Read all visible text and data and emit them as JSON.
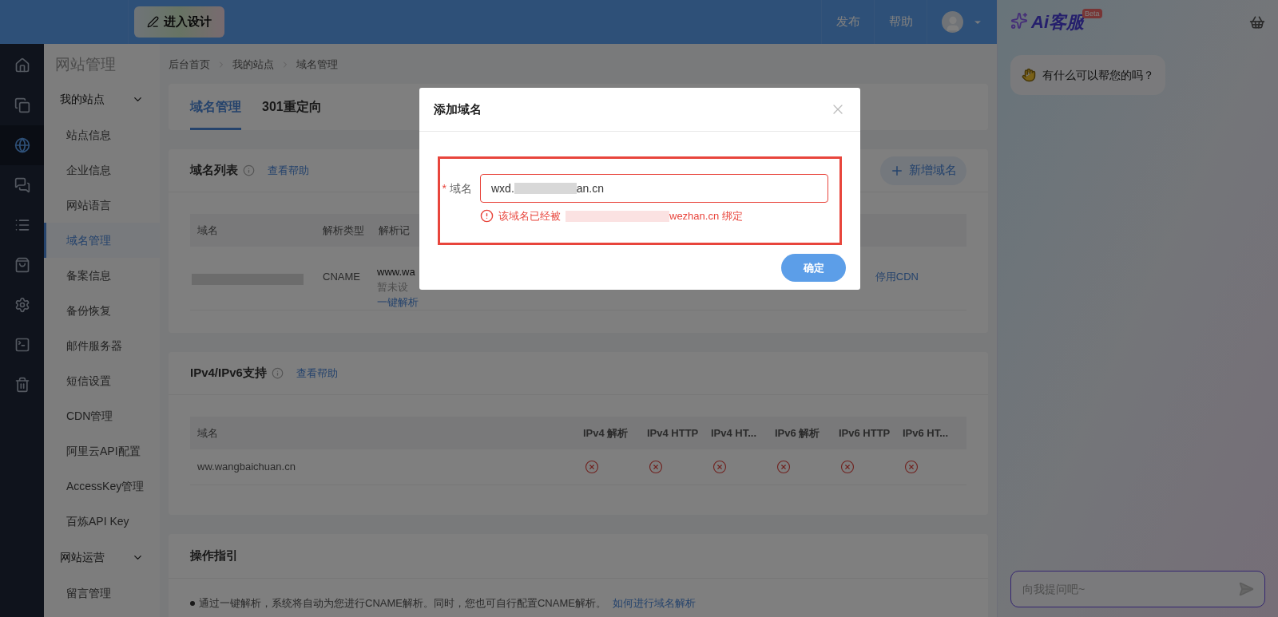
{
  "top_bar": {
    "design_button": "进入设计",
    "menu": [
      "发布",
      "帮助"
    ]
  },
  "icon_rail": [
    {
      "kind": "home",
      "selected": false
    },
    {
      "kind": "pages",
      "selected": false
    },
    {
      "kind": "globe",
      "selected": true
    },
    {
      "kind": "chat",
      "selected": false
    },
    {
      "kind": "list",
      "selected": false
    },
    {
      "kind": "bag",
      "selected": false
    },
    {
      "kind": "settings",
      "selected": false
    },
    {
      "kind": "terminal",
      "selected": false
    },
    {
      "kind": "trash",
      "selected": false
    }
  ],
  "sidebar": {
    "title": "网站管理",
    "groups": [
      {
        "label": "我的站点",
        "expanded": true,
        "items": [
          {
            "label": "站点信息",
            "selected": false
          },
          {
            "label": "企业信息",
            "selected": false
          },
          {
            "label": "网站语言",
            "selected": false
          },
          {
            "label": "域名管理",
            "selected": true
          },
          {
            "label": "备案信息",
            "selected": false
          },
          {
            "label": "备份恢复",
            "selected": false
          },
          {
            "label": "邮件服务器",
            "selected": false
          },
          {
            "label": "短信设置",
            "selected": false
          },
          {
            "label": "CDN管理",
            "selected": false
          },
          {
            "label": "阿里云API配置",
            "selected": false
          },
          {
            "label": "AccessKey管理",
            "selected": false
          },
          {
            "label": "百炼API Key",
            "selected": false
          }
        ]
      },
      {
        "label": "网站运营",
        "expanded": true,
        "items": [
          {
            "label": "留言管理",
            "selected": false
          }
        ]
      }
    ]
  },
  "breadcrumb": [
    "后台首页",
    "我的站点",
    "域名管理"
  ],
  "tabs": [
    {
      "label": "域名管理",
      "selected": true
    },
    {
      "label": "301重定向",
      "selected": false
    }
  ],
  "domain_list": {
    "title": "域名列表",
    "help_link": "查看帮助",
    "add_button": "新增域名",
    "columns": [
      "域名",
      "解析类型",
      "解析记"
    ],
    "rows": [
      {
        "type": "CNAME",
        "record": "www.wa",
        "note": "暂未设",
        "action": "一键解析",
        "right_link": "停用CDN"
      }
    ]
  },
  "ip_support": {
    "title": "IPv4/IPv6支持",
    "help_link": "查看帮助",
    "columns": [
      "域名",
      "IPv4 解析",
      "IPv4 HTTP",
      "IPv4 HT...",
      "IPv6 解析",
      "IPv6 HTTP",
      "IPv6 HT..."
    ],
    "rows": [
      {
        "domain": "ww.wangbaichuan.cn",
        "flags": [
          false,
          false,
          false,
          false,
          false,
          false
        ]
      }
    ]
  },
  "guide": {
    "title": "操作指引",
    "items": [
      {
        "text": "通过一键解析，系统将自动为您进行CNAME解析。同时，您也可自行配置CNAME解析。",
        "link": "如何进行域名解析"
      }
    ]
  },
  "dialog": {
    "title": "添加域名",
    "field": {
      "label": "域名",
      "required": true,
      "required_mark": "*",
      "value_start": "wxd.",
      "value_end": "an.cn",
      "error_start": "该域名已经被",
      "error_end": "wezhan.cn 绑定"
    },
    "confirm": "确定"
  },
  "assistant": {
    "logo": "Ai客服",
    "badge": "Beta",
    "messages": [
      {
        "text": "有什么可以帮您的吗？"
      }
    ],
    "input": {
      "placeholder": "向我提问吧~"
    }
  }
}
